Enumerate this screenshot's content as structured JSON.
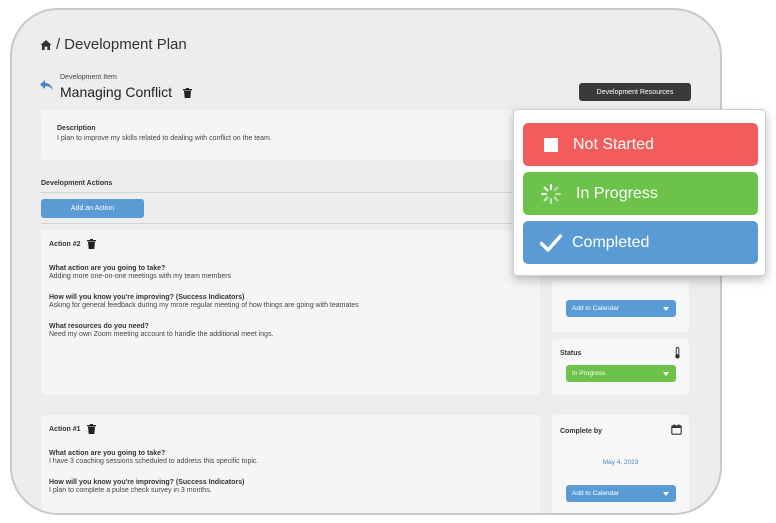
{
  "breadcrumb": {
    "separator": "/",
    "page_title": "Development Plan"
  },
  "item": {
    "kicker": "Development Item",
    "title": "Managing Conflict",
    "resources_button": "Development Resources"
  },
  "description": {
    "label": "Description",
    "text": "I plan to improve my skills related to dealing with conflict on the team."
  },
  "actions_section": {
    "label": "Development Actions",
    "add_button": "Add an Action"
  },
  "actions": [
    {
      "heading": "Action #2",
      "items": [
        {
          "question": "What action are you going to take?",
          "answer": "Adding more one-on-one meetings with my team members"
        },
        {
          "question": "How will you know you're improving? (Success Indicators)",
          "answer": "Asking for general feedback during my mrore regular meeting of how things are going with teamates"
        },
        {
          "question": "What resources do you need?",
          "answer": "Need my own Zoom meeting account to handle the additional meet ings."
        }
      ],
      "calendar_select": "Add to Calendar",
      "status_label": "Status",
      "status_select": "In Progress"
    },
    {
      "heading": "Action #1",
      "items": [
        {
          "question": "What action are you going to take?",
          "answer": "I have 3 coaching sessions scheduled to address this specific topic."
        },
        {
          "question": "How will you know you're improving? (Success Indicators)",
          "answer": "I plan to complete a pulse check survey in 3 months."
        }
      ],
      "complete_by_label": "Complete by",
      "complete_by_date": "May 4, 2023",
      "calendar_select": "Add to Calendar"
    }
  ],
  "status_options": [
    {
      "label": "Not Started",
      "color": "#f25c5c"
    },
    {
      "label": "In Progress",
      "color": "#6cc24a"
    },
    {
      "label": "Completed",
      "color": "#5b9bd5"
    }
  ],
  "colors": {
    "primary_blue": "#5b9bd5",
    "in_progress_green": "#6cc24a",
    "not_started_red": "#f25c5c",
    "dark_button": "#3a3a3a"
  },
  "icons": [
    "home-icon",
    "undo-icon",
    "trash-icon",
    "calendar-icon",
    "thermometer-icon",
    "stop-square-icon",
    "spinner-icon",
    "checkmark-icon",
    "caret-down-icon"
  ]
}
